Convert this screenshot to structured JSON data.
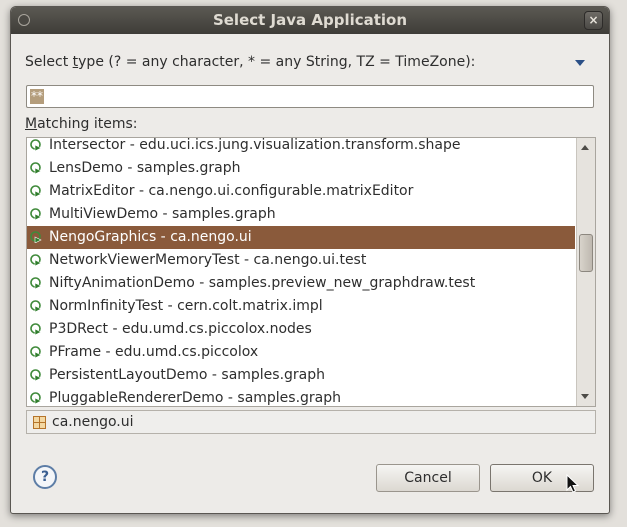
{
  "window": {
    "title": "Select Java Application",
    "close_glyph": "×"
  },
  "type_label": {
    "before": "Select ",
    "mnemonic": "t",
    "after": "ype (? = any character, * = any String, TZ = TimeZone):"
  },
  "search": {
    "value": "**"
  },
  "matching_label": {
    "mnemonic": "M",
    "rest": "atching items:"
  },
  "items": [
    {
      "label": "Intersector - edu.uci.ics.jung.visualization.transform.shape",
      "selected": false
    },
    {
      "label": "LensDemo - samples.graph",
      "selected": false
    },
    {
      "label": "MatrixEditor - ca.nengo.ui.configurable.matrixEditor",
      "selected": false
    },
    {
      "label": "MultiViewDemo - samples.graph",
      "selected": false
    },
    {
      "label": "NengoGraphics - ca.nengo.ui",
      "selected": true
    },
    {
      "label": "NetworkViewerMemoryTest - ca.nengo.ui.test",
      "selected": false
    },
    {
      "label": "NiftyAnimationDemo - samples.preview_new_graphdraw.test",
      "selected": false
    },
    {
      "label": "NormInfinityTest - cern.colt.matrix.impl",
      "selected": false
    },
    {
      "label": "P3DRect - edu.umd.cs.piccolox.nodes",
      "selected": false
    },
    {
      "label": "PFrame - edu.umd.cs.piccolox",
      "selected": false
    },
    {
      "label": "PersistentLayoutDemo - samples.graph",
      "selected": false
    },
    {
      "label": "PluggableRendererDemo - samples.graph",
      "selected": false
    }
  ],
  "icons": {
    "item": "java-application-icon",
    "package": "package-icon",
    "help": "help-icon"
  },
  "package": {
    "label": "ca.nengo.ui"
  },
  "buttons": {
    "help": "?",
    "cancel": "Cancel",
    "ok": "OK"
  },
  "colors": {
    "selection": "#8a5a3b",
    "title_bar": "#3e3c38"
  }
}
